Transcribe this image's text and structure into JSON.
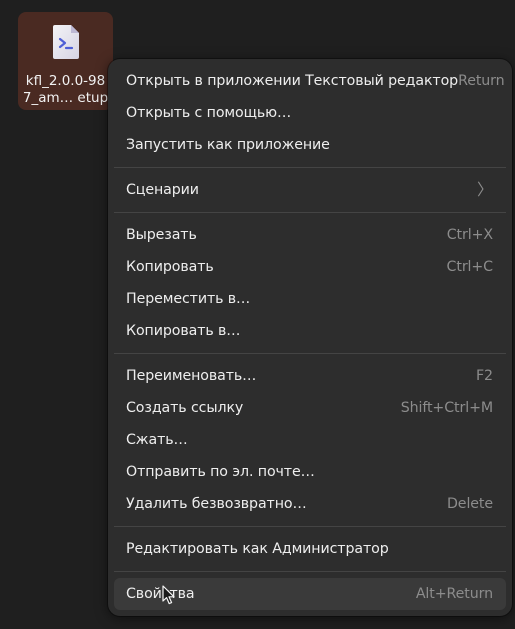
{
  "desktop_file": {
    "label_line1": "kfl_2.0.0-98",
    "label_line2": "7_am… etup",
    "icon": "terminal-script-file-icon",
    "tile_color": "#4a2a22"
  },
  "context_menu": {
    "groups": [
      [
        {
          "label": "Открыть в приложении Текстовый редактор",
          "shortcut": "Return"
        },
        {
          "label": "Открыть с помощью…",
          "shortcut": ""
        },
        {
          "label": "Запустить как приложение",
          "shortcut": ""
        }
      ],
      [
        {
          "label": "Сценарии",
          "shortcut": "",
          "submenu": true,
          "submenu_icon": "chevron-right-icon"
        }
      ],
      [
        {
          "label": "Вырезать",
          "shortcut": "Ctrl+X"
        },
        {
          "label": "Копировать",
          "shortcut": "Ctrl+C"
        },
        {
          "label": "Переместить в…",
          "shortcut": ""
        },
        {
          "label": "Копировать в…",
          "shortcut": ""
        }
      ],
      [
        {
          "label": "Переименовать…",
          "shortcut": "F2"
        },
        {
          "label": "Создать ссылку",
          "shortcut": "Shift+Ctrl+M"
        },
        {
          "label": "Сжать…",
          "shortcut": ""
        },
        {
          "label": "Отправить по эл. почте…",
          "shortcut": ""
        },
        {
          "label": "Удалить безвозвратно…",
          "shortcut": "Delete"
        }
      ],
      [
        {
          "label": "Редактировать как Администратор",
          "shortcut": ""
        }
      ],
      [
        {
          "label": "Свойства",
          "shortcut": "Alt+Return",
          "hovered": true
        }
      ]
    ]
  },
  "colors": {
    "menu_bg": "#2d2d2d",
    "hover_bg": "#3a3a3a",
    "text": "#eeeeee",
    "shortcut_text": "#8c8c8c",
    "separator": "#444444",
    "desktop_bg": "#1f1f1f"
  }
}
